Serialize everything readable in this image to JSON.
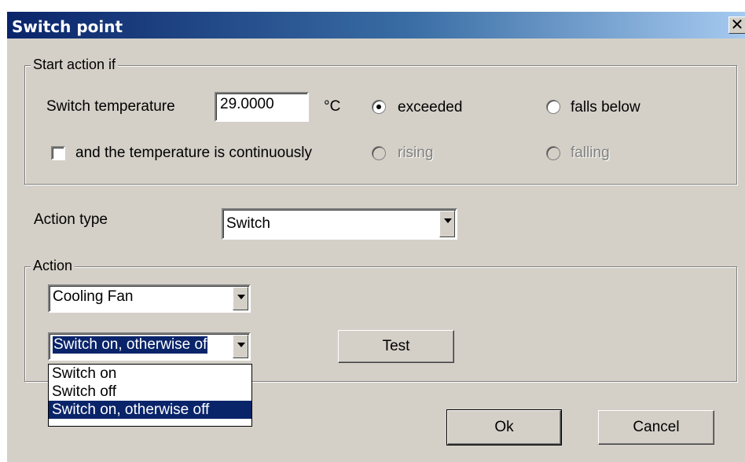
{
  "window": {
    "title": "Switch point",
    "close_glyph": "✕"
  },
  "start_group": {
    "legend": "Start action if",
    "switch_temperature_label": "Switch temperature",
    "temperature_value": "29.0000",
    "unit": "°C",
    "exceeded_label": "exceeded",
    "exceeded_checked": true,
    "falls_below_label": "falls below",
    "continuous_label": "and the temperature is continuously",
    "continuous_checked": false,
    "rising_label": "rising",
    "falling_label": "falling"
  },
  "action_type": {
    "label": "Action type",
    "value": "Switch"
  },
  "action_group": {
    "legend": "Action",
    "device_value": "Cooling Fan",
    "mode_value": "Switch on, otherwise of",
    "test_label": "Test",
    "mode_options": [
      "Switch on",
      "Switch off",
      "Switch on, otherwise off"
    ],
    "mode_selected_index": 2
  },
  "buttons": {
    "ok_label": "Ok",
    "cancel_label": "Cancel"
  },
  "colors": {
    "face": "#d4d0c8",
    "title_start": "#0a246a",
    "title_end": "#a6caf0",
    "highlight": "#0a246a"
  }
}
